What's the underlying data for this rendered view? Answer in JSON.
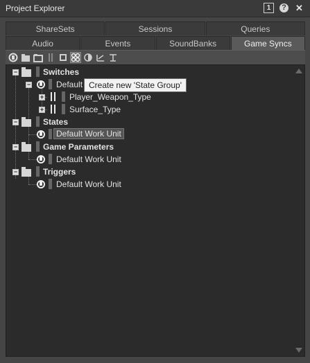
{
  "window": {
    "title": "Project Explorer",
    "pin_label": "1",
    "help_label": "?",
    "close_label": "✕"
  },
  "tabs_top": [
    {
      "label": "ShareSets"
    },
    {
      "label": "Sessions"
    },
    {
      "label": "Queries"
    }
  ],
  "tabs_bottom": [
    {
      "label": "Audio"
    },
    {
      "label": "Events"
    },
    {
      "label": "SoundBanks"
    },
    {
      "label": "Game Syncs",
      "active": true
    }
  ],
  "toolbar": {
    "icons": [
      "work-unit-icon",
      "folder-icon",
      "virtual-folder-icon",
      "switch-group-icon",
      "switch-icon",
      "state-group-icon",
      "state-icon",
      "game-parameter-icon",
      "trigger-icon"
    ]
  },
  "tree": {
    "switches": {
      "label": "Switches",
      "work_unit": "Default",
      "children": [
        "Player_Weapon_Type",
        "Surface_Type"
      ]
    },
    "states": {
      "label": "States",
      "work_unit": "Default Work Unit"
    },
    "game_parameters": {
      "label": "Game Parameters",
      "work_unit": "Default Work Unit"
    },
    "triggers": {
      "label": "Triggers",
      "work_unit": "Default Work Unit"
    }
  },
  "tooltip": {
    "text": "Create new 'State Group'"
  },
  "colors": {
    "background": "#454545",
    "tree_background": "#2b2b2b",
    "active_tab": "#5a5a5a"
  }
}
